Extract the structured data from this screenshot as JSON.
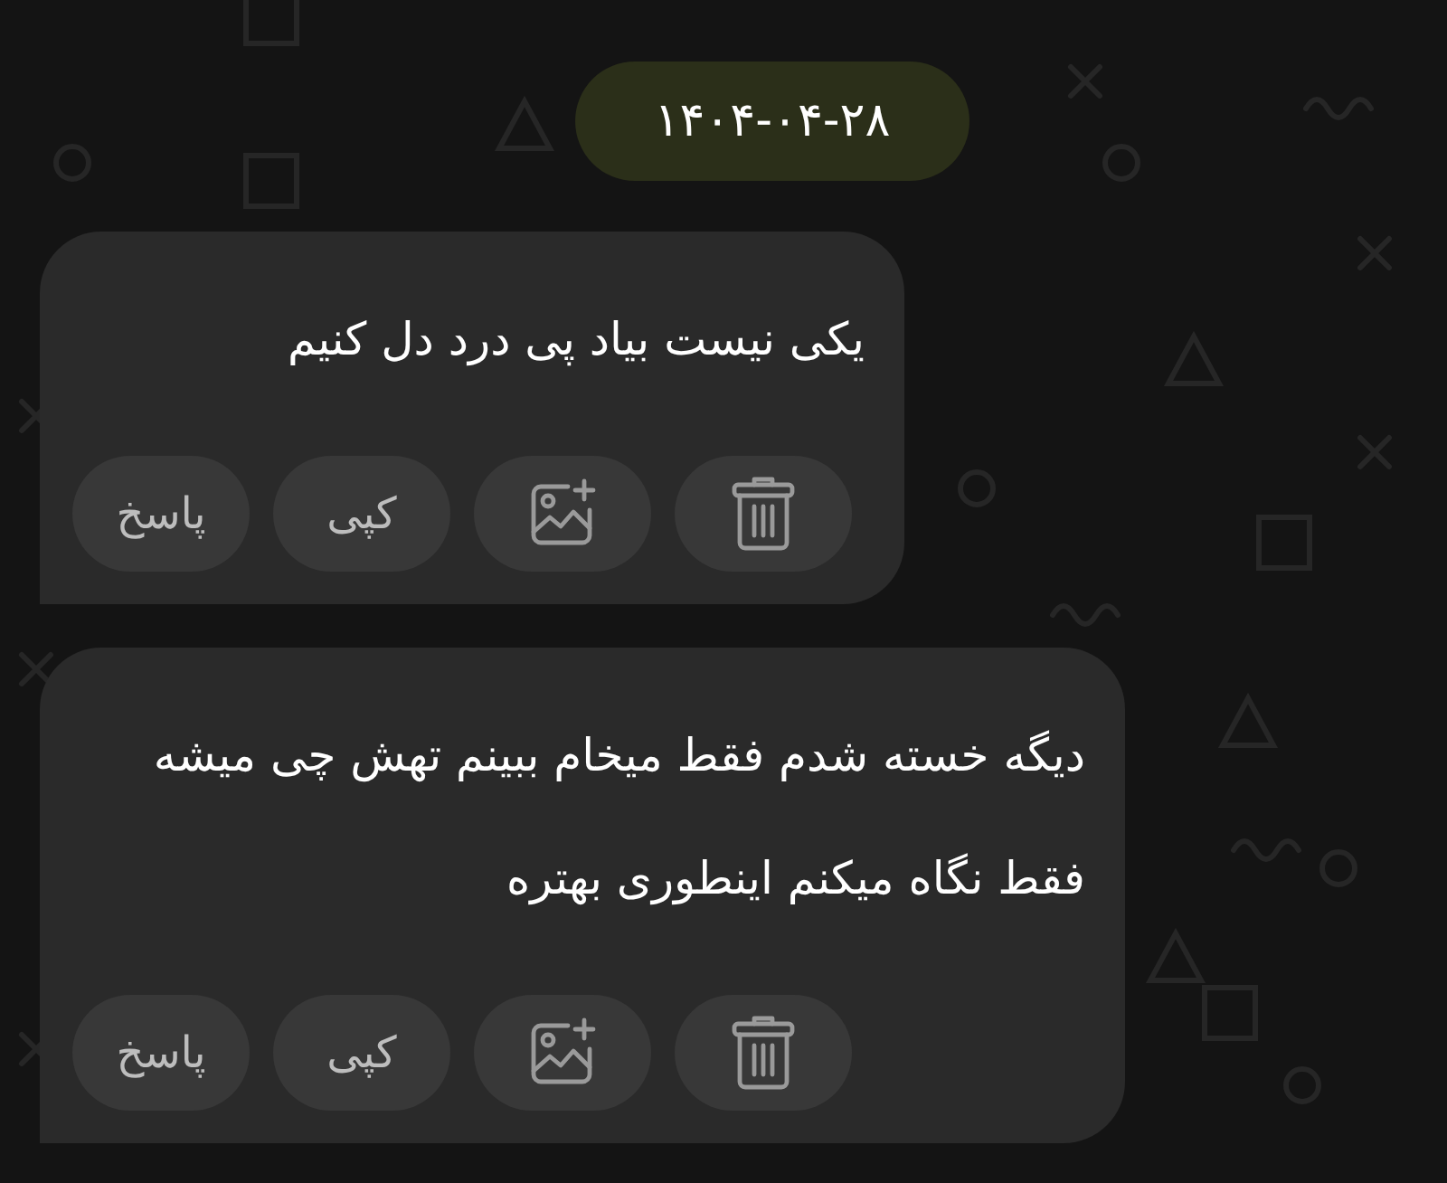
{
  "date_badge": "۱۴۰۴-۰۴-۲۸",
  "messages": [
    {
      "text": "یکی نیست بیاد پی درد دل کنیم",
      "actions": [
        {
          "kind": "delete"
        },
        {
          "kind": "add_image"
        },
        {
          "kind": "copy",
          "label": "کپی"
        },
        {
          "kind": "reply",
          "label": "پاسخ"
        }
      ]
    },
    {
      "text": "دیگه خسته شدم فقط میخام ببینم تهش چی میشه فقط نگاه میکنم اینطوری بهتره",
      "actions": [
        {
          "kind": "delete"
        },
        {
          "kind": "add_image"
        },
        {
          "kind": "copy",
          "label": "کپی"
        },
        {
          "kind": "reply",
          "label": "پاسخ"
        }
      ]
    }
  ]
}
